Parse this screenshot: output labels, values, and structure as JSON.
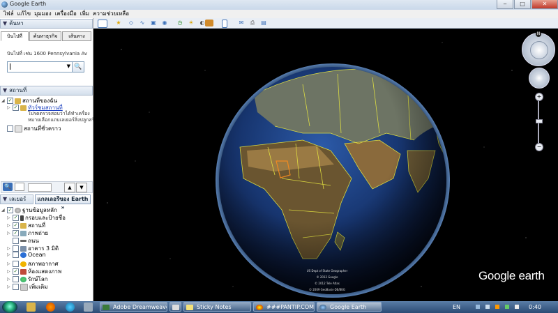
{
  "window": {
    "title": "Google Earth",
    "controls": [
      "‒",
      "□",
      "✕"
    ]
  },
  "menu": [
    "ไฟล์",
    "แก้ไข",
    "มุมมอง",
    "เครื่องมือ",
    "เพิ่ม",
    "ความช่วยเหลือ"
  ],
  "search": {
    "header": "ค้นหา",
    "tabs": [
      "บินไปที่",
      "ค้นหาธุรกิจ",
      "เส้นทาง"
    ],
    "hint": "บินไปที่ เช่น 1600 Pennsylvania Av",
    "value": ""
  },
  "places": {
    "header": "สถานที่",
    "my_places": "สถานที่ของฉัน",
    "sightseeing": "ทัวร์ชมสถานที่",
    "sightseeing_desc1": "โปรดตรวจสอบว่าได้ทำเครื่อง",
    "sightseeing_desc2": "หมายเลือกแถบเลเยอร์สิ่งปลูกสร้า",
    "temporary": "สถานที่ชั่วคราว"
  },
  "layers": {
    "header": "เลเยอร์",
    "gallery_button": "แกลเลอรีของ Earth",
    "gallery_arrow": "»",
    "primary_db": "ฐานข้อมูลหลัก",
    "items": [
      "กรอบและป้ายชื่อ",
      "สถานที่",
      "ภาพถ่าย",
      "ถนน",
      "อาคาร 3 มิติ",
      "Ocean",
      "สภาพอากาศ",
      "ห้องแสดงภาพ",
      "รักษ์โลก",
      "เพิ่มเติม"
    ]
  },
  "attribution": [
    "US Dept of State Geographer",
    "© 2012 Google",
    "© 2012 Tele Atlas",
    "© 2009 GeoBasis-DE/BKG"
  ],
  "logo": "Google earth",
  "compass_letter": "N",
  "taskbar": {
    "apps": [
      "Adobe Dreamweaver...",
      "Sticky Notes",
      "###PANTIP.COM##...",
      "Google Earth"
    ],
    "lang": "EN",
    "time": "0:40"
  }
}
